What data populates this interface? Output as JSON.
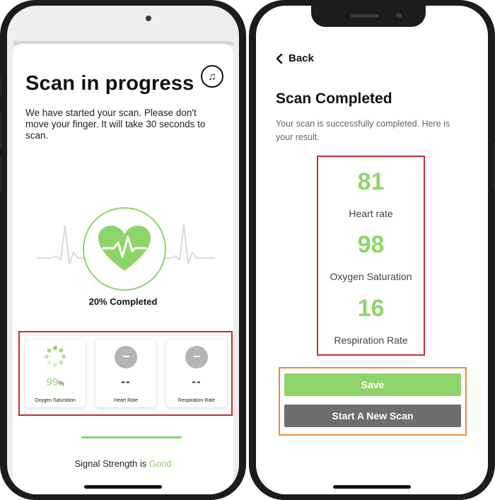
{
  "left_screen": {
    "title": "Scan in progress",
    "music_icon": "music-note-icon",
    "description": "We have started your scan. Please don't move your finger. It will take 30 seconds to scan.",
    "progress_text": "20% Completed",
    "progress": 0.2,
    "metrics": [
      {
        "label": "Oxygen Saturation",
        "value": "99",
        "unit": "%"
      },
      {
        "label": "Heart Rate",
        "value": "--"
      },
      {
        "label": "Respiration Rate",
        "value": "--"
      }
    ],
    "signal_prefix": "Signal Strength is",
    "signal_value": "Good"
  },
  "right_screen": {
    "back_label": "Back",
    "title": "Scan Completed",
    "description": "Your scan is successfully completed. Here is your result.",
    "results": [
      {
        "value": "81",
        "label": "Heart rate"
      },
      {
        "value": "98",
        "label": "Oxygen Saturation"
      },
      {
        "value": "16",
        "label": "Respiration Rate"
      }
    ],
    "save_label": "Save",
    "new_scan_label": "Start A New Scan"
  },
  "colors": {
    "accent": "#8fd46a",
    "highlight_red": "#cc2b2b",
    "highlight_orange": "#ef8a32",
    "button_gray": "#6e6e6e"
  }
}
